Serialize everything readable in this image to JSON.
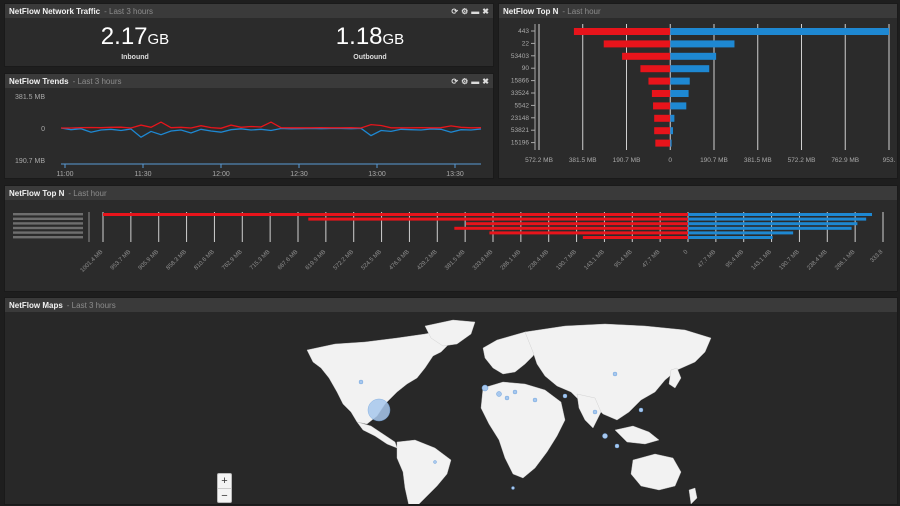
{
  "traffic": {
    "title": "NetFlow Network Traffic",
    "subtitle": "- Last 3 hours",
    "inbound": {
      "value": "2.17",
      "unit": "GB",
      "label": "Inbound"
    },
    "outbound": {
      "value": "1.18",
      "unit": "GB",
      "label": "Outbound"
    }
  },
  "trends": {
    "title": "NetFlow Trends",
    "subtitle": "- Last 3 hours",
    "y_ticks": [
      "381.5 MB",
      "0",
      "190.7 MB"
    ],
    "x_ticks": [
      "11:00",
      "11:30",
      "12:00",
      "12:30",
      "13:00",
      "13:30"
    ]
  },
  "topn_ports": {
    "title": "NetFlow Top N",
    "subtitle": "- Last hour",
    "x_ticks": [
      "572.2 MB",
      "381.5 MB",
      "190.7 MB",
      "0",
      "190.7 MB",
      "381.5 MB",
      "572.2 MB",
      "762.9 MB",
      "953."
    ]
  },
  "topn_hosts": {
    "title": "NetFlow Top N",
    "subtitle": "- Last hour",
    "x_ticks": [
      "1001.4 MB",
      "953.7 MB",
      "905.9 MB",
      "858.3 MB",
      "810.6 MB",
      "762.9 MB",
      "715.3 MB",
      "667.6 MB",
      "619.9 MB",
      "572.2 MB",
      "524.5 MB",
      "476.8 MB",
      "429.2 MB",
      "381.5 MB",
      "333.8 MB",
      "286.1 MB",
      "238.4 MB",
      "190.7 MB",
      "143.1 MB",
      "95.4 MB",
      "47.7 MB",
      "0",
      "47.7 MB",
      "95.4 MB",
      "143.1 MB",
      "190.7 MB",
      "238.4 MB",
      "286.1 MB",
      "333.8"
    ]
  },
  "maps": {
    "title": "NetFlow Maps",
    "subtitle": "- Last 3 hours",
    "zoom_in": "+",
    "zoom_out": "−"
  },
  "controls": {
    "refresh": "⟳",
    "settings": "⚙",
    "minimize": "▬",
    "close": "✖"
  },
  "colors": {
    "inbound": "#e8141b",
    "outbound": "#1e88d2",
    "land": "#f2f2f2",
    "bubble": "#a8c8ee"
  },
  "chart_data": [
    {
      "type": "line",
      "x_ticks": [
        "11:00",
        "11:30",
        "12:00",
        "12:30",
        "13:00",
        "13:30"
      ],
      "ylim": [
        -190.7,
        381.5
      ],
      "y_unit": "MB",
      "series": [
        {
          "values": [
            0,
            0,
            5,
            6,
            3,
            8,
            10,
            0,
            35,
            8,
            70,
            4,
            8,
            0,
            28,
            5,
            -2,
            35,
            8,
            18,
            12,
            70,
            4,
            2,
            2,
            2,
            3,
            2,
            2,
            3,
            0,
            40,
            30,
            2,
            2,
            2,
            4,
            2,
            3,
            25,
            8,
            2,
            4
          ]
        },
        {
          "values": [
            0,
            -10,
            -4,
            -25,
            -12,
            -8,
            -15,
            -6,
            -55,
            -20,
            -40,
            -18,
            -12,
            -30,
            -8,
            -18,
            -25,
            -10,
            -5,
            -12,
            -8,
            -15,
            -3,
            -5,
            -4,
            -3,
            -4,
            -3,
            -3,
            -4,
            -2,
            -45,
            -15,
            -20,
            -8,
            -10,
            -12,
            -6,
            -8,
            -25,
            -10,
            -12,
            -6
          ]
        }
      ]
    },
    {
      "type": "bar",
      "categories": [
        "443",
        "22",
        "53403",
        "90",
        "15866",
        "33524",
        "5542",
        "23148",
        "53821",
        "15196"
      ],
      "xlim": [
        -572.2,
        953.7
      ],
      "x_unit": "MB",
      "series": [
        {
          "values": [
            -420,
            -290,
            -210,
            -130,
            -95,
            -80,
            -75,
            -70,
            -70,
            -65
          ]
        },
        {
          "values": [
            1140,
            280,
            200,
            170,
            85,
            80,
            70,
            18,
            12,
            6
          ]
        }
      ]
    },
    {
      "type": "bar",
      "categories": [
        "",
        "",
        "",
        "",
        "",
        ""
      ],
      "xlim": [
        -1001.4,
        333.8
      ],
      "x_unit": "MB",
      "series": [
        {
          "values": [
            -1001.4,
            -650,
            -380,
            -400,
            -340,
            -180
          ]
        },
        {
          "values": [
            315,
            305,
            290,
            280,
            180,
            145
          ]
        }
      ]
    }
  ]
}
